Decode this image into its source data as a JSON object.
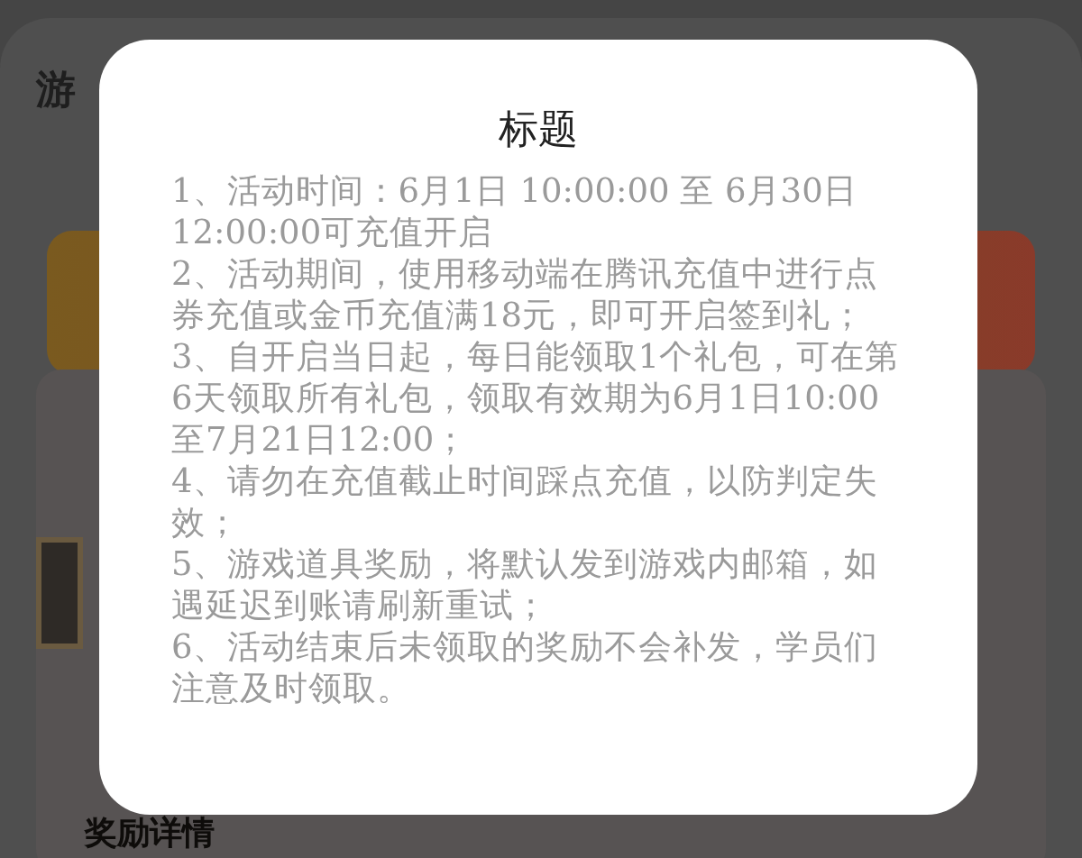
{
  "background_page": {
    "header_title": "游",
    "section_title": "奖励详情"
  },
  "dialog": {
    "title": "标题",
    "paragraphs": [
      "1、活动时间：6月1日 10:00:00 至 6月30日 12:00:00可充值开启",
      "2、活动期间，使用移动端在腾讯充值中进行点券充值或金币充值满18元，即可开启签到礼；",
      "3、自开启当日起，每日能领取1个礼包，可在第6天领取所有礼包，领取有效期为6月1日10:00至7月21日12:00；",
      "4、请勿在充值截止时间踩点充值，以防判定失效；",
      "5、游戏道具奖励，将默认发到游戏内邮箱，如遇延迟到账请刷新重试；",
      "6、活动结束后未领取的奖励不会补发，学员们注意及时领取。"
    ]
  }
}
